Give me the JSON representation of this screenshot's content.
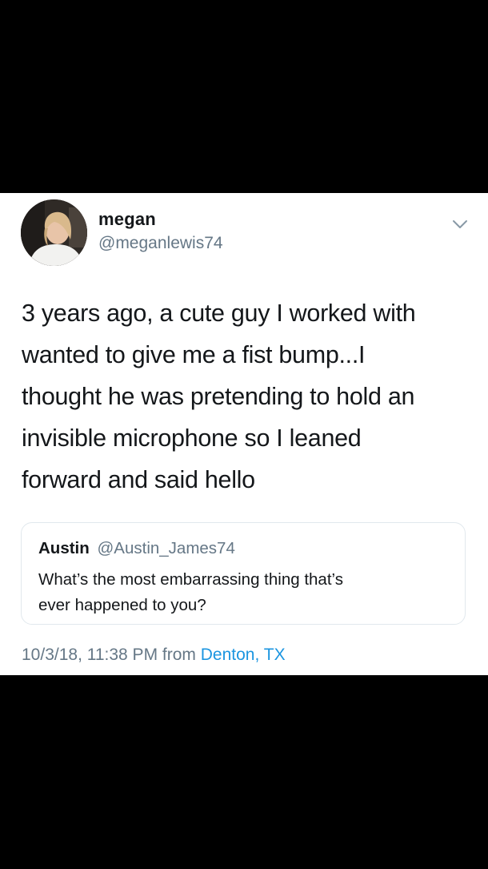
{
  "colors": {
    "background_bars": "#000000",
    "card": "#ffffff",
    "text_primary": "#14171a",
    "text_secondary": "#657786",
    "link": "#1b95e0",
    "quote_border": "#e1e8ed"
  },
  "author": {
    "display_name": "megan",
    "handle": "@meganlewis74",
    "avatar_icon": "profile-photo"
  },
  "menu": {
    "icon": "chevron-down-icon"
  },
  "tweet": {
    "lines": [
      "3 years ago, a cute guy I worked with",
      "wanted to give me a fist bump...I",
      "thought he was pretending to hold an",
      "invisible microphone so I leaned",
      "forward and said hello"
    ]
  },
  "quoted_tweet": {
    "display_name": "Austin",
    "handle": "@Austin_James74",
    "lines": [
      "What’s the most embarrassing thing that’s",
      "ever happened to you?"
    ]
  },
  "meta": {
    "timestamp": "10/3/18, 11:38 PM",
    "from_label": "from",
    "location": "Denton, TX"
  }
}
